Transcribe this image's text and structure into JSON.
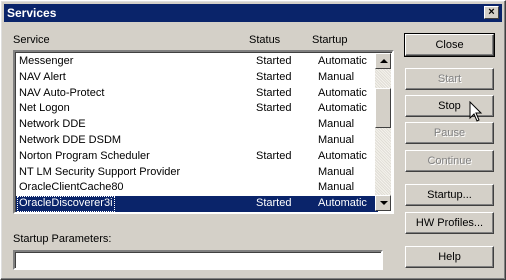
{
  "window": {
    "title": "Services"
  },
  "columns": {
    "service": "Service",
    "status": "Status",
    "startup": "Startup"
  },
  "services": [
    {
      "name": "Messenger",
      "status": "Started",
      "startup": "Automatic"
    },
    {
      "name": "NAV Alert",
      "status": "Started",
      "startup": "Manual"
    },
    {
      "name": "NAV Auto-Protect",
      "status": "Started",
      "startup": "Automatic"
    },
    {
      "name": "Net Logon",
      "status": "Started",
      "startup": "Automatic"
    },
    {
      "name": "Network DDE",
      "status": "",
      "startup": "Manual"
    },
    {
      "name": "Network DDE DSDM",
      "status": "",
      "startup": "Manual"
    },
    {
      "name": "Norton Program Scheduler",
      "status": "Started",
      "startup": "Automatic"
    },
    {
      "name": "NT LM Security Support Provider",
      "status": "",
      "startup": "Manual"
    },
    {
      "name": "OracleClientCache80",
      "status": "",
      "startup": "Manual"
    },
    {
      "name": "OracleDiscoverer3i",
      "status": "Started",
      "startup": "Automatic"
    }
  ],
  "selected_index": 9,
  "startup_params": {
    "label": "Startup Parameters:",
    "value": ""
  },
  "buttons": {
    "close": "Close",
    "start": "Start",
    "stop": "Stop",
    "pause": "Pause",
    "continue": "Continue",
    "startup": "Startup...",
    "hw_profiles": "HW Profiles...",
    "help": "Help"
  },
  "colors": {
    "titlebar": "#0a246a",
    "selection": "#0a246a",
    "face": "#d4d0c8"
  },
  "icons": {
    "close": "close-x-icon",
    "cursor": "arrow-cursor-icon"
  }
}
